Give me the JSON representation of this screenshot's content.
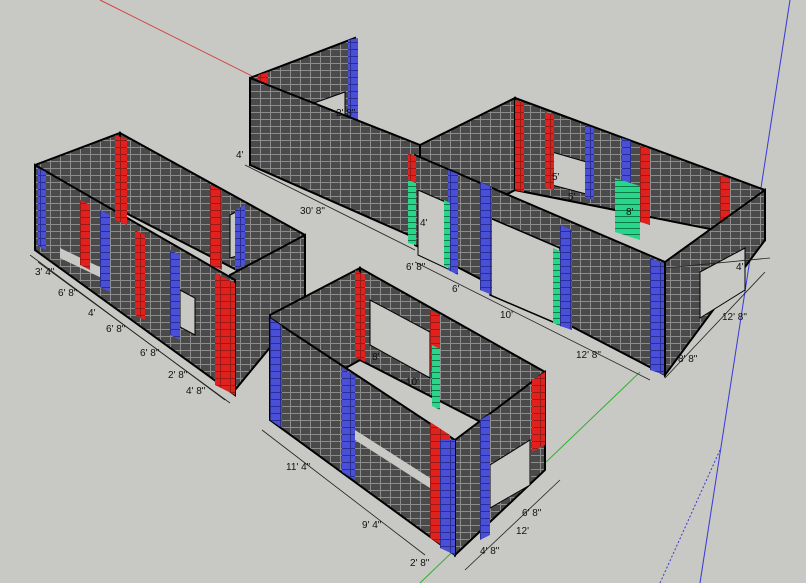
{
  "scene": {
    "background": "#c8c8c4",
    "colors": {
      "block": "#4a4a4a",
      "grid": "#8c8c8c",
      "edge": "#000000",
      "red": "#e0211d",
      "blue": "#4a4fd8",
      "green": "#28d68a",
      "axis_red": "#d24040",
      "axis_green": "#30b030",
      "axis_blue": "#3838d8"
    }
  },
  "dimensions": {
    "left_bldg": [
      "3' 4\"",
      "6' 8\"",
      "4'",
      "6' 8\"",
      "6' 8\"",
      "2' 8\"",
      "4' 8\""
    ],
    "large_bldg": [
      "4'",
      "2' 8\"",
      "30' 8\"",
      "6' 8\"",
      "4'",
      "6'",
      "10'",
      "12' 8\"",
      "5'",
      "5'",
      "4'",
      "12' 8\"",
      "8' 8\"",
      "8'"
    ],
    "front_bldg": [
      "10'",
      "11' 4\"",
      "9' 4\"",
      "2' 8\"",
      "4' 8\"",
      "12'",
      "6' 8\"",
      "8'"
    ]
  }
}
